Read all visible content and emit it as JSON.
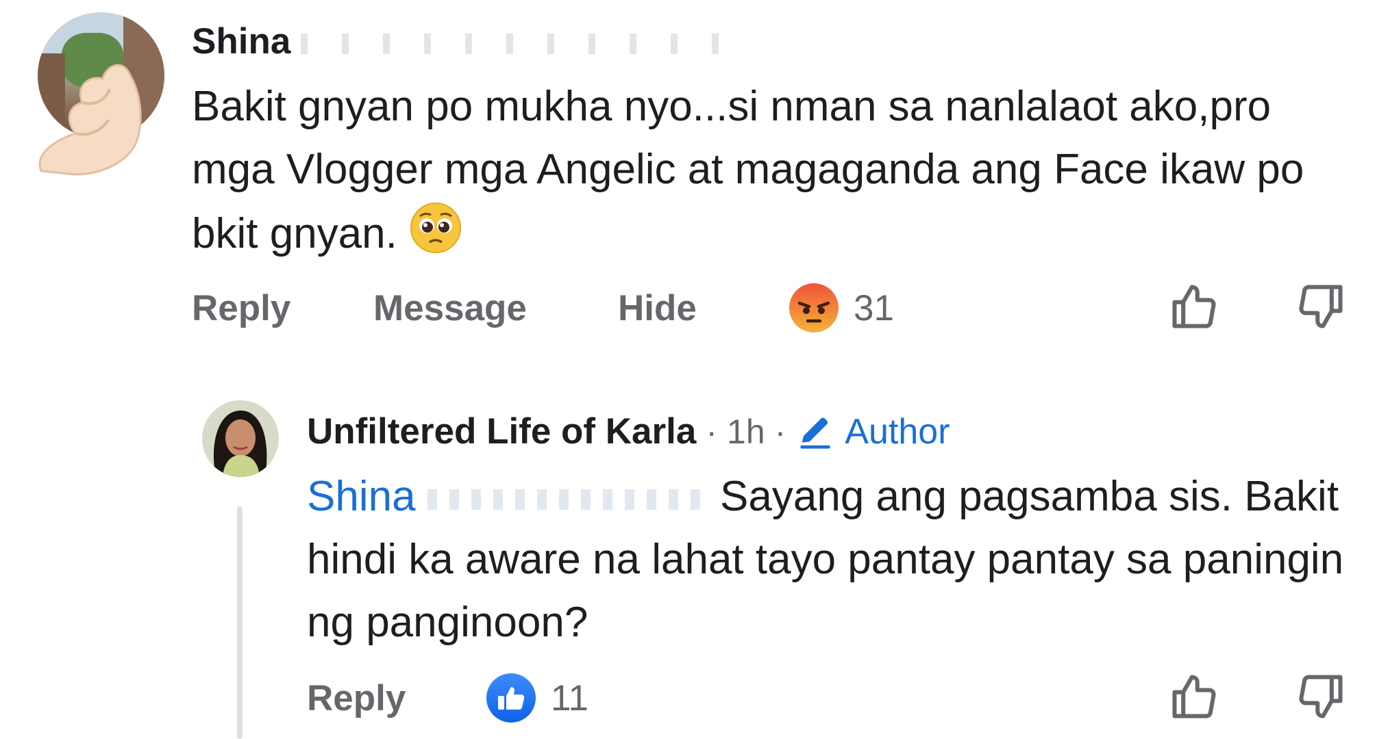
{
  "comment": {
    "author_visible": "Shina",
    "text": "Bakit gnyan po mukha nyo...si nman sa nanlalaot ako,pro mga Vlogger mga Angelic at magaganda ang Face ikaw po bkit gnyan.",
    "emoji": "pleading-face",
    "actions": {
      "reply": "Reply",
      "message": "Message",
      "hide": "Hide"
    },
    "reaction": {
      "type": "angry",
      "count": "31"
    }
  },
  "reply": {
    "author": "Unfiltered Life of Karla",
    "separator_1": "·",
    "time": "1h",
    "separator_2": "·",
    "badge": "Author",
    "mention_visible": "Shina",
    "text": "Sayang ang pagsamba sis. Bakit hindi ka aware na lahat tayo pantay pantay sa paningin ng panginoon?",
    "actions": {
      "reply": "Reply"
    },
    "reaction": {
      "type": "like",
      "count": "11"
    }
  },
  "colors": {
    "text": "#1c1e21",
    "secondary": "#65676b",
    "link": "#1a6ed8",
    "like_blue": "#1877f2",
    "angry": "#f15a3a"
  }
}
